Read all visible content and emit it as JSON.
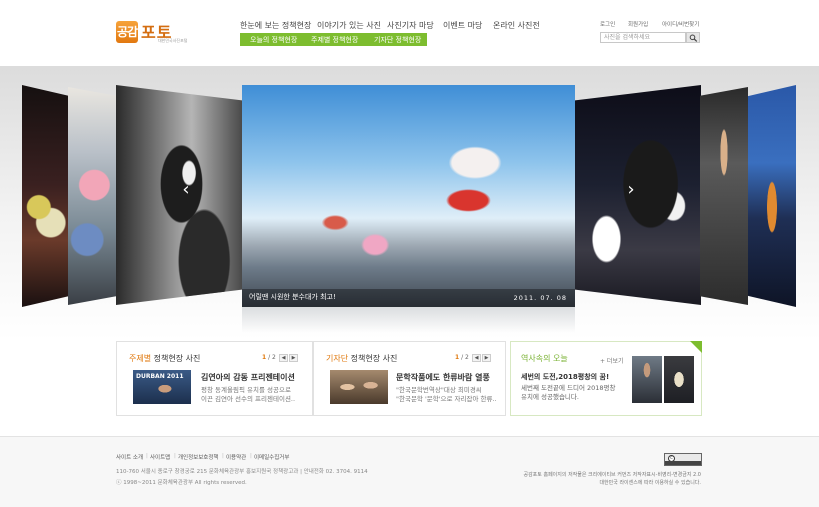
{
  "header": {
    "logo_badge": "공감",
    "logo_name": "포토",
    "logo_sub": "대한민국사진포털",
    "nav": [
      "한눈에 보는 정책현장",
      "이야기가 있는 사진",
      "사진기자 마당",
      "이벤트 마당",
      "온라인 사진전"
    ],
    "subnav": [
      "오늘의 정책현장",
      "주제별 정책현장",
      "기자단 정책현장"
    ],
    "util": [
      "로그인",
      "회원가입",
      "아이디/비번찾기"
    ],
    "search_placeholder": "사진을 검색하세요"
  },
  "gallery": {
    "caption": "어릴땐 시원한 분수대가 최고!",
    "date": "2011. 07. 08",
    "prev": "‹",
    "next": "›"
  },
  "box1": {
    "title_hl": "주제별",
    "title_rest": " 정책현장 사진",
    "page_current": "1",
    "page_total": "/ 2",
    "headline": "김연아의 감동 프리젠테이션",
    "text1": "평창 동계올림픽 유치를 성공으로",
    "text2": "이끈 김연아 선수의 프리젠테이션..",
    "thumb_text": "DURBAN 2011"
  },
  "box2": {
    "title_hl": "기자단",
    "title_rest": " 정책현장 사진",
    "page_current": "1",
    "page_total": "/ 2",
    "headline": "문학작품에도 한류바람 열풍",
    "text1": "\"한국문학번역상\"대상 최미경씨",
    "text2": "\"한국문학 '문학'으로 자리잡아 한류.."
  },
  "box3": {
    "title": "역사속의 오늘",
    "more": "+ 더보기",
    "headline": "세번의 도전,2018평창의 꿈!",
    "text1": "세번째 도전끝에 드디어 2018평창",
    "text2": "유치에 성공했습니다."
  },
  "footer": {
    "links": [
      "사이트 소개",
      "사이트맵",
      "개인정보보호정책",
      "이용약관",
      "이메일수집거부"
    ],
    "address": "110-760 서울시 종로구 창경궁로 215 문화체육관광부 홍보지원국 정책광고과   |   안내전화  02. 3704. 9114",
    "copyright": "ⓒ 1998~2011 문화체육관광부 All rights reserved.",
    "license1": "공감포토 홈페이지의 저작물은 크리에이티브 커먼즈 저작자표시-비영리-변경금지 2.0",
    "license2": "대한민국 라이센스에 따라 이용하실 수 있습니다."
  },
  "colors": {
    "accent_green": "#7dbd2f",
    "accent_orange": "#e07a10"
  }
}
